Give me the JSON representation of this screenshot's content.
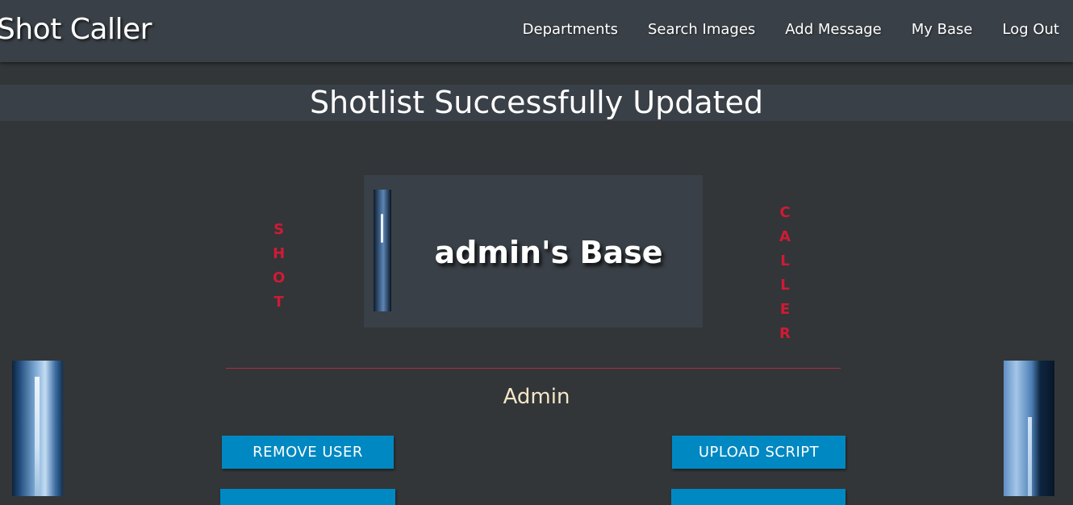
{
  "brand": "Shot Caller",
  "nav": {
    "items": [
      "Departments",
      "Search Images",
      "Add Message",
      "My Base",
      "Log Out"
    ]
  },
  "banner": {
    "message": "Shotlist Successfully Updated"
  },
  "decor": {
    "left_word": [
      "S",
      "H",
      "O",
      "T"
    ],
    "right_word": [
      "C",
      "A",
      "L",
      "L",
      "E",
      "R"
    ],
    "accent_color": "#d11a35"
  },
  "base": {
    "title": "admin's Base"
  },
  "user": {
    "name": "Admin"
  },
  "actions": {
    "remove_user": "REMOVE USER",
    "upload_script": "UPLOAD SCRIPT"
  },
  "colors": {
    "navbar": "#3a4047",
    "background": "#323638",
    "button": "#0088c2"
  }
}
